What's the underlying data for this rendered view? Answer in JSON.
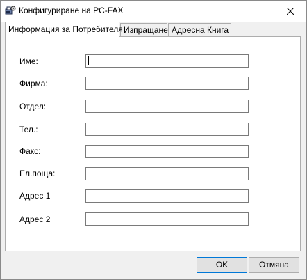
{
  "window": {
    "title": "Конфигуриране на PC-FAX"
  },
  "tabs": [
    {
      "label": "Информация за Потребителя",
      "active": true
    },
    {
      "label": "Изпращане",
      "active": false
    },
    {
      "label": "Адресна Книга",
      "active": false
    }
  ],
  "form": {
    "fields": [
      {
        "label": "Име:",
        "value": ""
      },
      {
        "label": "Фирма:",
        "value": ""
      },
      {
        "label": "Отдел:",
        "value": ""
      },
      {
        "label": "Тел.:",
        "value": ""
      },
      {
        "label": "Факс:",
        "value": ""
      },
      {
        "label": "Ел.поща:",
        "value": ""
      },
      {
        "label": "Адрес 1",
        "value": ""
      },
      {
        "label": "Адрес 2",
        "value": ""
      }
    ]
  },
  "buttons": {
    "ok_label": "OK",
    "cancel_label": "Отмяна"
  },
  "icons": {
    "app": "fax-settings-icon",
    "close": "close-icon"
  }
}
